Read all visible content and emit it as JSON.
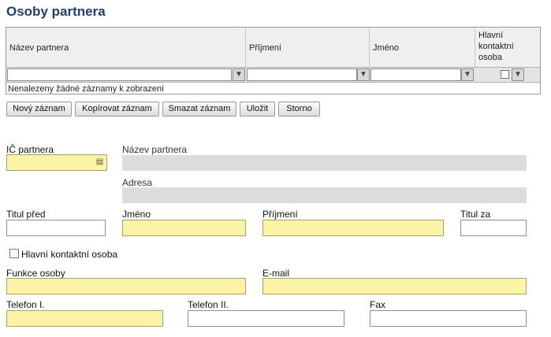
{
  "page_title": "Osoby partnera",
  "grid": {
    "columns": [
      {
        "label": "Název partnera"
      },
      {
        "label": "Příjmení"
      },
      {
        "label": "Jméno"
      },
      {
        "label": "Hlavní kontaktní osoba"
      }
    ],
    "empty_message": "Nenalezeny žádné záznamy k zobrazení"
  },
  "toolbar": {
    "new_label": "Nový záznam",
    "copy_label": "Kopírovat záznam",
    "delete_label": "Smazat záznam",
    "save_label": "Uložit",
    "cancel_label": "Storno"
  },
  "form": {
    "ic_label": "IČ partnera",
    "ic_value": "",
    "partner_name_label": "Název partnera",
    "address_label": "Adresa",
    "title_before_label": "Titul před",
    "first_name_label": "Jméno",
    "last_name_label": "Příjmení",
    "title_after_label": "Titul za",
    "main_contact_label": "Hlavní kontaktní osoba",
    "main_contact_checked": false,
    "position_label": "Funkce osoby",
    "email_label": "E-mail",
    "phone1_label": "Telefon I.",
    "phone2_label": "Telefon II.",
    "fax_label": "Fax"
  },
  "colors": {
    "title": "#1f3f6e",
    "required_field": "#fbf3a6",
    "readonly_field": "#dcdcdc"
  },
  "icons": {
    "filter": "filter-icon",
    "lookup": "lookup-icon"
  }
}
